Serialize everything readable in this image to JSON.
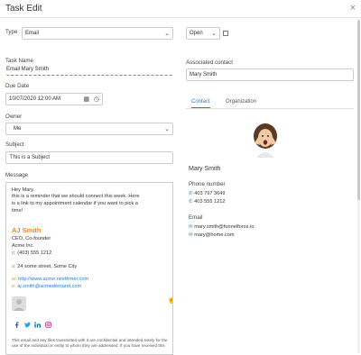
{
  "window": {
    "title": "Task Edit",
    "close_glyph": "×"
  },
  "form": {
    "type_label": "Type",
    "type_value": "Email",
    "status_value": "Open",
    "task_name_label": "Task Name",
    "task_name_value": "Email Mary Smith",
    "due_date_label": "Due Date",
    "due_date_value": "10/07/2020 12:00 AM",
    "owner_label": "Owner",
    "owner_value": "Me",
    "subject_label": "Subject",
    "subject_value": "This is a Subject",
    "message_label": "Message"
  },
  "message": {
    "greeting": "Hey Mary,",
    "line1": "this is a reminder that we should connect this week. Here",
    "line2": "is a link to my appointment calendar if you want to pick a",
    "line3": "time!",
    "sig_name": "AJ Smith",
    "sig_title": "CEO, Co-founder",
    "sig_company": "Acme Inc",
    "sig_phone_prefix": "p:",
    "sig_phone": "(403) 555 1212",
    "sig_addr_prefix": "a:",
    "sig_addr": "24 some street, Some City",
    "sig_web_prefix": "w:",
    "sig_web": "http://www.acme.nextfrmer.com",
    "sig_email_prefix": "e:",
    "sig_email": "aj.smith@acmedemand.com",
    "footer1": "This email and any files transmitted with it are confidential and intended solely for the",
    "footer2": "use of the individual or entity to whom they are addressed. If you have received this"
  },
  "contact_panel": {
    "associated_label": "Associated contact",
    "associated_value": "Mary Smith",
    "tabs": [
      "Contact",
      "Organization"
    ],
    "name": "Mary Smith",
    "phone_label": "Phone number",
    "phones": [
      "403 797 3649",
      "403 555 1212"
    ],
    "email_label": "Email",
    "emails": [
      "mary.smith@funnelforce.io",
      "mary@home.com"
    ]
  },
  "colors": {
    "accent": "#2a7cc7",
    "signature_name": "#f08a1c",
    "facebook": "#3b5998",
    "twitter": "#1da1f2",
    "linkedin": "#0077b5",
    "instagram": "#c13584"
  }
}
